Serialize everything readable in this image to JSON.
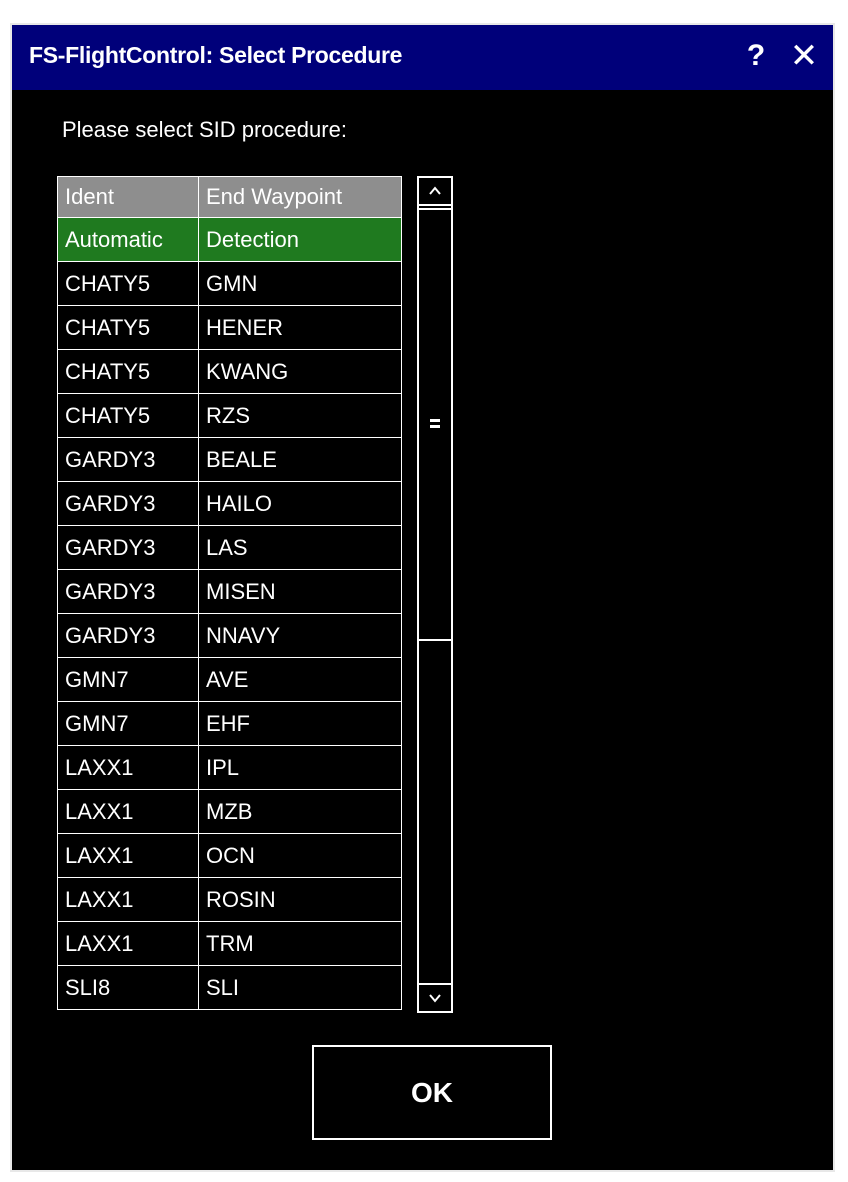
{
  "window": {
    "title": "FS-FlightControl: Select Procedure",
    "help_label": "?",
    "close_label": "✕"
  },
  "prompt": "Please select SID procedure:",
  "table": {
    "columns": [
      "Ident",
      "End Waypoint"
    ],
    "selected_index": 0,
    "rows": [
      [
        "Automatic",
        "Detection"
      ],
      [
        "CHATY5",
        "GMN"
      ],
      [
        "CHATY5",
        "HENER"
      ],
      [
        "CHATY5",
        "KWANG"
      ],
      [
        "CHATY5",
        "RZS"
      ],
      [
        "GARDY3",
        "BEALE"
      ],
      [
        "GARDY3",
        "HAILO"
      ],
      [
        "GARDY3",
        "LAS"
      ],
      [
        "GARDY3",
        "MISEN"
      ],
      [
        "GARDY3",
        "NNAVY"
      ],
      [
        "GMN7",
        "AVE"
      ],
      [
        "GMN7",
        "EHF"
      ],
      [
        "LAXX1",
        "IPL"
      ],
      [
        "LAXX1",
        "MZB"
      ],
      [
        "LAXX1",
        "OCN"
      ],
      [
        "LAXX1",
        "ROSIN"
      ],
      [
        "LAXX1",
        "TRM"
      ],
      [
        "SLI8",
        "SLI"
      ]
    ]
  },
  "scrollbar": {
    "up_icon": "chevron-up-icon",
    "down_icon": "chevron-down-icon",
    "thumb_icon": "grip-icon"
  },
  "buttons": {
    "ok_label": "OK"
  },
  "colors": {
    "titlebar": "#00007a",
    "selected_row": "#1f7a1f",
    "header": "#8e8e8e",
    "background": "#000000"
  }
}
